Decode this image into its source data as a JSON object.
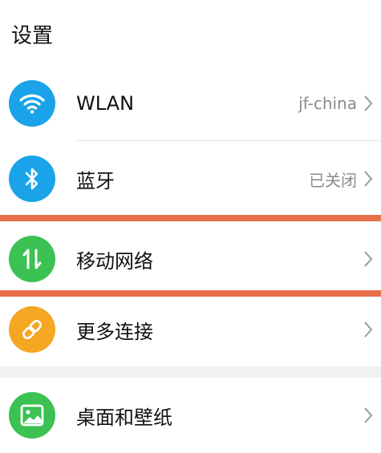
{
  "header": {
    "title": "设置"
  },
  "rows": [
    {
      "label": "WLAN",
      "value": "jf-china",
      "icon": "wifi-icon",
      "color": "#1aa3e8"
    },
    {
      "label": "蓝牙",
      "value": "已关闭",
      "icon": "bluetooth-icon",
      "color": "#1aa3e8"
    },
    {
      "label": "移动网络",
      "value": "",
      "icon": "mobile-data-icon",
      "color": "#3cc153"
    },
    {
      "label": "更多连接",
      "value": "",
      "icon": "link-icon",
      "color": "#f5a623"
    },
    {
      "label": "桌面和壁纸",
      "value": "",
      "icon": "wallpaper-icon",
      "color": "#3cc153"
    }
  ],
  "colors": {
    "highlight": "#e8704c",
    "chevron": "#9a9a9a"
  }
}
